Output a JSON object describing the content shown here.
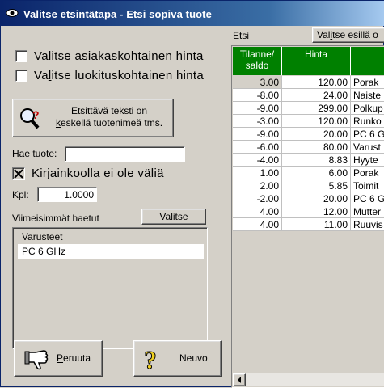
{
  "window": {
    "title": "Valitse etsintätapa - Etsi sopiva tuote"
  },
  "options": {
    "customer_price": {
      "accel": "V",
      "rest": "alitse asiakaskohtainen hinta",
      "checked": false
    },
    "class_price": {
      "pre": "Va",
      "accel": "l",
      "rest": "itse luokituskohtainen hinta",
      "checked": false
    }
  },
  "search_mode_button": {
    "line1": "Etsittävä teksti on",
    "line2": "keskellä tuotenimeä tms.",
    "line2_accel": "k",
    "line2_rest": "eskellä tuotenimeä tms."
  },
  "search": {
    "label": "Hae tuote:",
    "value": ""
  },
  "case_insensitive": {
    "label": "Kirjainkoolla ei ole väliä",
    "checked": true
  },
  "quantity": {
    "label": "Kpl:",
    "value": "1.0000"
  },
  "recent": {
    "label": "Viimeisimmät haetut",
    "select_label_pre": "Val",
    "select_label_accel": "i",
    "select_label_rest": "tse",
    "items": [
      "Varusteet",
      "PC 6 GHz"
    ]
  },
  "actions": {
    "cancel": {
      "accel": "P",
      "rest": "eruuta"
    },
    "help": {
      "label": "Neuvo"
    }
  },
  "results": {
    "etsi_label": "Etsi",
    "select_shown_pre": "Val",
    "select_shown_accel": "i",
    "select_shown_rest": "tse esillä o",
    "columns": [
      "Tilanne/\nsaldo",
      "Hinta",
      ""
    ],
    "rows": [
      [
        "3.00",
        "120.00",
        "Porak"
      ],
      [
        "-8.00",
        "24.00",
        "Naiste"
      ],
      [
        "-9.00",
        "299.00",
        "Polkup"
      ],
      [
        "-3.00",
        "120.00",
        "Runko"
      ],
      [
        "-9.00",
        "20.00",
        "PC 6 G"
      ],
      [
        "-6.00",
        "80.00",
        "Varust"
      ],
      [
        "-4.00",
        "8.83",
        "Hyyte"
      ],
      [
        "1.00",
        "6.00",
        "Porak"
      ],
      [
        "2.00",
        "5.85",
        "Toimit"
      ],
      [
        "-2.00",
        "20.00",
        "PC 6 G"
      ],
      [
        "4.00",
        "12.00",
        "Mutter"
      ],
      [
        "4.00",
        "11.00",
        "Ruuvis"
      ]
    ]
  }
}
